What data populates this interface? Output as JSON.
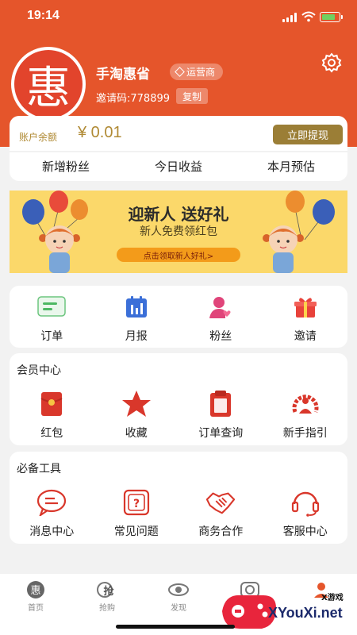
{
  "status_bar": {
    "time": "19:14"
  },
  "profile": {
    "avatar_char": "惠",
    "username": "手淘惠省",
    "role": "运营商",
    "invite": "邀请码:778899",
    "copy_label": "复制"
  },
  "balance": {
    "label": "账户余额",
    "value": "¥ 0.01",
    "withdraw_label": "立即提现"
  },
  "stats": [
    "新增粉丝",
    "今日收益",
    "本月预估"
  ],
  "banner": {
    "title": "迎新人 送好礼",
    "subtitle": "新人免费领红包",
    "cta": "点击领取新人好礼>"
  },
  "quick_menu": [
    {
      "label": "订单",
      "icon": "order-icon"
    },
    {
      "label": "月报",
      "icon": "report-icon"
    },
    {
      "label": "粉丝",
      "icon": "fans-icon"
    },
    {
      "label": "邀请",
      "icon": "invite-gift-icon"
    }
  ],
  "member_center": {
    "title": "会员中心",
    "items": [
      {
        "label": "红包",
        "icon": "red-envelope-icon"
      },
      {
        "label": "收藏",
        "icon": "star-icon"
      },
      {
        "label": "订单查询",
        "icon": "clipboard-icon"
      },
      {
        "label": "新手指引",
        "icon": "guide-icon"
      }
    ]
  },
  "tools": {
    "title": "必备工具",
    "items": [
      {
        "label": "消息中心",
        "icon": "message-icon"
      },
      {
        "label": "常见问题",
        "icon": "question-icon"
      },
      {
        "label": "商务合作",
        "icon": "handshake-icon"
      },
      {
        "label": "客服中心",
        "icon": "headset-icon"
      }
    ]
  },
  "tabbar": [
    {
      "label": "首页",
      "icon": "home-hui-icon"
    },
    {
      "label": "抢购",
      "icon": "rush-buy-icon"
    },
    {
      "label": "发现",
      "icon": "discover-icon"
    },
    {
      "label": "",
      "icon": "camera-icon"
    },
    {
      "label": "",
      "icon": "profile-icon"
    }
  ],
  "watermark": {
    "small": "X游戏",
    "big": "XYouXi.net"
  },
  "colors": {
    "brand": "#e5552b",
    "gold": "#9b7e36",
    "icon_red": "#d9372b"
  }
}
